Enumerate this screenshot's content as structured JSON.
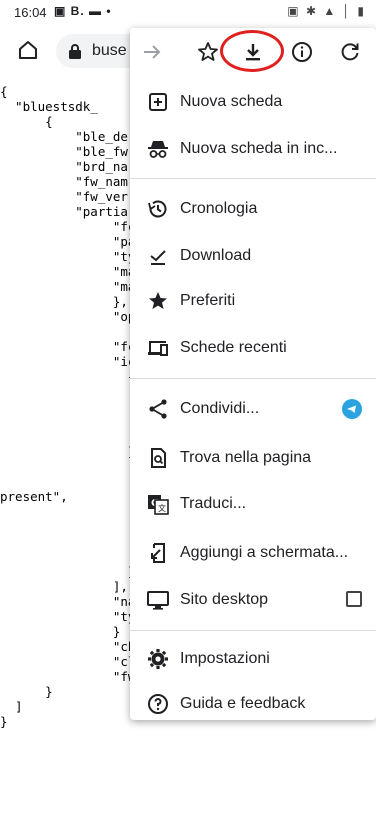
{
  "status_bar": {
    "time": "16:04",
    "left_icons": "▣ B. ▬ •",
    "right_icons": "▣ ✱ ▲ │ ▮"
  },
  "toolbar": {
    "url": "buse"
  },
  "json_lines": [
    "{",
    "  \"bluestsdk_",
    "      {",
    "          \"ble_de",
    "          \"ble_fw",
    "          \"brd_na",
    "          \"fw_nam",
    "          \"fw_ver",
    "          \"partia",
    "               \"fc",
    "               \"pa",
    "               \"ty",
    "               \"ma",
    "               \"ma",
    "               },",
    "               \"op",
    "",
    "               \"fc",
    "               \"ic",
    "                 {",
    "",
    "",
    "",
    "",
    "                 }",
    "",
    "",
    "present\",",
    "",
    "",
    "",
    "",
    "                 }",
    "               ],",
    "               \"na",
    "               \"ty",
    "               }",
    "               \"ch",
    "               \"cloud_apps\": [],",
    "               \"fw_desc\": \"\"",
    "      }",
    "  ]",
    "}"
  ],
  "menu": {
    "items": [
      {
        "label": "Nuova scheda",
        "icon": "new-tab-icon"
      },
      {
        "label": "Nuova scheda in inc...",
        "icon": "incognito-icon"
      },
      {
        "label": "Cronologia",
        "icon": "history-icon"
      },
      {
        "label": "Download",
        "icon": "download-done-icon"
      },
      {
        "label": "Preferiti",
        "icon": "star-filled-icon"
      },
      {
        "label": "Schede recenti",
        "icon": "recent-tabs-icon"
      },
      {
        "label": "Condividi...",
        "icon": "share-icon"
      },
      {
        "label": "Trova nella pagina",
        "icon": "find-in-page-icon"
      },
      {
        "label": "Traduci...",
        "icon": "translate-icon"
      },
      {
        "label": "Aggiungi a schermata...",
        "icon": "add-to-home-icon"
      },
      {
        "label": "Sito desktop",
        "icon": "desktop-icon"
      },
      {
        "label": "Impostazioni",
        "icon": "settings-icon"
      },
      {
        "label": "Guida e feedback",
        "icon": "help-icon"
      }
    ]
  },
  "colors": {
    "highlight": "#e0201f",
    "telegram": "#2aa3e0"
  }
}
